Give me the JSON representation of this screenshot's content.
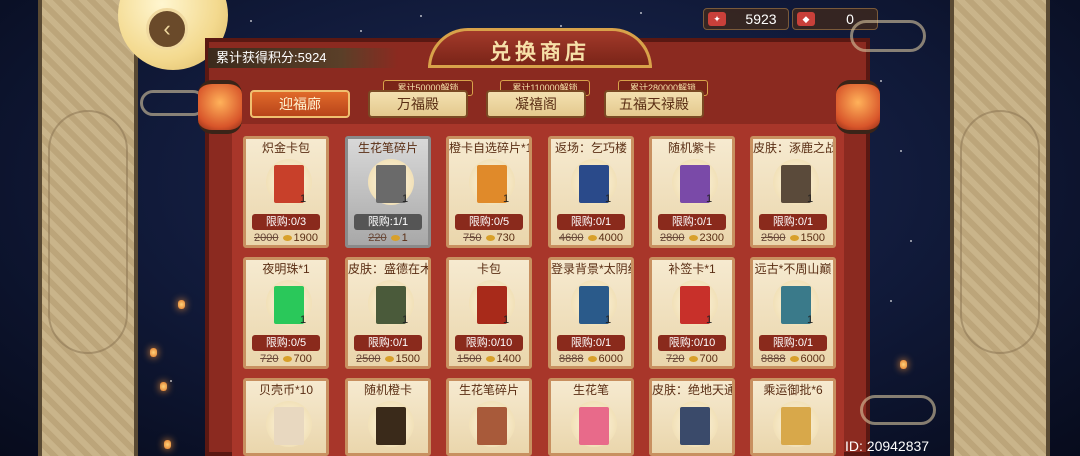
{
  "header": {
    "back_icon": "back-arrow-icon"
  },
  "currencies": [
    {
      "name": "points",
      "value": "5923",
      "icon": "coin-purse-icon",
      "color": "#c8403a"
    },
    {
      "name": "tokens",
      "value": "0",
      "icon": "token-icon",
      "color": "#c8403a"
    }
  ],
  "score_text": "累计获得积分:5924",
  "shop_title": "兑换商店",
  "tabs": [
    {
      "label": "迎福廊",
      "lock": "",
      "active": true
    },
    {
      "label": "万福殿",
      "lock": "累计50000解锁",
      "active": false
    },
    {
      "label": "凝禧阁",
      "lock": "累计110000解锁",
      "active": false
    },
    {
      "label": "五福天禄殿",
      "lock": "累计280000解锁",
      "active": false
    }
  ],
  "items": [
    {
      "name": "炽金卡包",
      "qty": "1",
      "limit": "限购:0/3",
      "old_price": "2000",
      "price": "1900",
      "color": "#c8402a",
      "owned": false
    },
    {
      "name": "生花笔碎片",
      "qty": "1",
      "limit": "限购:1/1",
      "old_price": "220",
      "price": "1",
      "color": "#6a6a6a",
      "owned": true
    },
    {
      "name": "橙卡自选碎片*1",
      "qty": "1",
      "limit": "限购:0/5",
      "old_price": "750",
      "price": "730",
      "color": "#e08a2a",
      "owned": false
    },
    {
      "name": "返场：乞巧楼",
      "qty": "1",
      "limit": "限购:0/1",
      "old_price": "4600",
      "price": "4000",
      "color": "#2a4a8a",
      "owned": false
    },
    {
      "name": "随机紫卡",
      "qty": "1",
      "limit": "限购:0/1",
      "old_price": "2800",
      "price": "2300",
      "color": "#7a4aa8",
      "owned": false
    },
    {
      "name": "皮肤：涿鹿之战",
      "qty": "1",
      "limit": "限购:0/1",
      "old_price": "2500",
      "price": "1500",
      "color": "#5a4a3a",
      "owned": false
    },
    {
      "name": "夜明珠*1",
      "qty": "1",
      "limit": "限购:0/5",
      "old_price": "720",
      "price": "700",
      "color": "#2ac85a",
      "owned": false
    },
    {
      "name": "皮肤：盛德在木",
      "qty": "1",
      "limit": "限购:0/1",
      "old_price": "2500",
      "price": "1500",
      "color": "#4a5a3a",
      "owned": false
    },
    {
      "name": "卡包",
      "qty": "1",
      "limit": "限购:0/10",
      "old_price": "1500",
      "price": "1400",
      "color": "#a82a1a",
      "owned": false
    },
    {
      "name": "登录背景*太阴纪年",
      "qty": "1",
      "limit": "限购:0/1",
      "old_price": "8888",
      "price": "6000",
      "color": "#2a5a8a",
      "owned": false
    },
    {
      "name": "补签卡*1",
      "qty": "1",
      "limit": "限购:0/10",
      "old_price": "720",
      "price": "700",
      "color": "#c8302a",
      "owned": false
    },
    {
      "name": "远古*不周山巅",
      "qty": "1",
      "limit": "限购:0/1",
      "old_price": "8888",
      "price": "6000",
      "color": "#3a7a8a",
      "owned": false
    },
    {
      "name": "贝壳币*10",
      "qty": "",
      "limit": "",
      "old_price": "",
      "price": "",
      "color": "#e8d8c0",
      "owned": false
    },
    {
      "name": "随机橙卡",
      "qty": "",
      "limit": "",
      "old_price": "",
      "price": "",
      "color": "#3a2a1a",
      "owned": false
    },
    {
      "name": "生花笔碎片",
      "qty": "",
      "limit": "",
      "old_price": "",
      "price": "",
      "color": "#a85a3a",
      "owned": false
    },
    {
      "name": "生花笔",
      "qty": "",
      "limit": "",
      "old_price": "",
      "price": "",
      "color": "#e86a8a",
      "owned": false
    },
    {
      "name": "皮肤：绝地天通",
      "qty": "",
      "limit": "",
      "old_price": "",
      "price": "",
      "color": "#3a4a6a",
      "owned": false
    },
    {
      "name": "乘运御批*6",
      "qty": "",
      "limit": "",
      "old_price": "",
      "price": "",
      "color": "#d8a84a",
      "owned": false
    }
  ],
  "player_id": "ID: 20942837"
}
